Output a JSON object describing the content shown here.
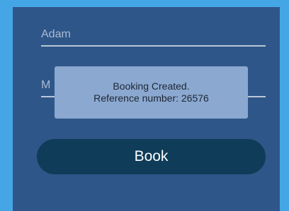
{
  "form": {
    "first_name_value": "Adam",
    "last_name_value": "M",
    "book_label": "Book"
  },
  "toast": {
    "line1": "Booking Created.",
    "line2": "Reference number: 26576"
  },
  "colors": {
    "outer_background": "#45a6e6",
    "panel_background": "#2f5688",
    "button_background": "#0f3c59",
    "toast_background": "#8ba8d0"
  }
}
